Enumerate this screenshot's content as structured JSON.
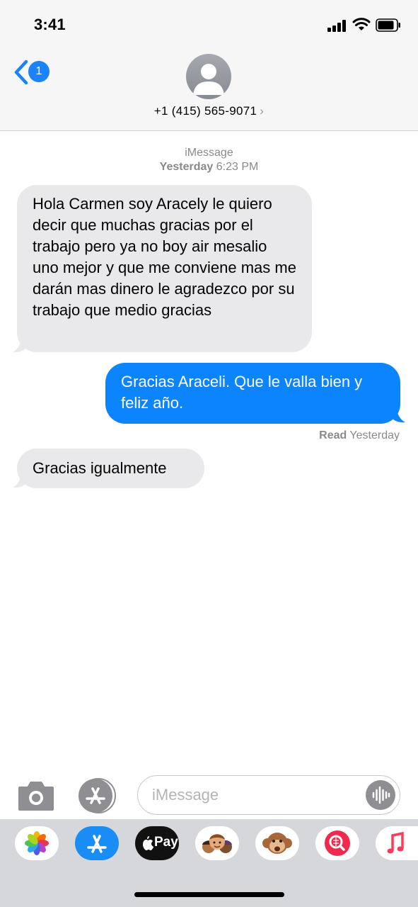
{
  "status_bar": {
    "time": "3:41"
  },
  "header": {
    "back_badge": "1",
    "contact": "+1 (415) 565-9071",
    "contact_chevron": "›"
  },
  "conversation": {
    "service": "iMessage",
    "timestamp_day": "Yesterday",
    "timestamp_time": "6:23 PM",
    "messages": [
      {
        "direction": "incoming",
        "text": "Hola Carmen soy Aracely le quiero decir que muchas gracias por el trabajo pero ya no boy air mesalio uno mejor y que me conviene mas  me darán mas dinero le agradezco  por su trabajo que medio gracias"
      },
      {
        "direction": "outgoing",
        "text": "Gracias Araceli. Que le valla bien y feliz año."
      },
      {
        "direction": "incoming",
        "text": "Gracias igualmente"
      }
    ],
    "read_label": "Read",
    "read_time": "Yesterday"
  },
  "composer": {
    "placeholder": "iMessage"
  },
  "app_drawer": {
    "apps": [
      {
        "name": "photos-icon"
      },
      {
        "name": "app-store-icon"
      },
      {
        "name": "apple-pay-icon",
        "label": "Pay"
      },
      {
        "name": "memoji-icon"
      },
      {
        "name": "animoji-monkey-icon"
      },
      {
        "name": "image-search-icon"
      },
      {
        "name": "music-icon"
      }
    ]
  },
  "colors": {
    "outgoing_bubble": "#0b84fe",
    "incoming_bubble": "#e9e9eb",
    "accent": "#1a82fb"
  }
}
